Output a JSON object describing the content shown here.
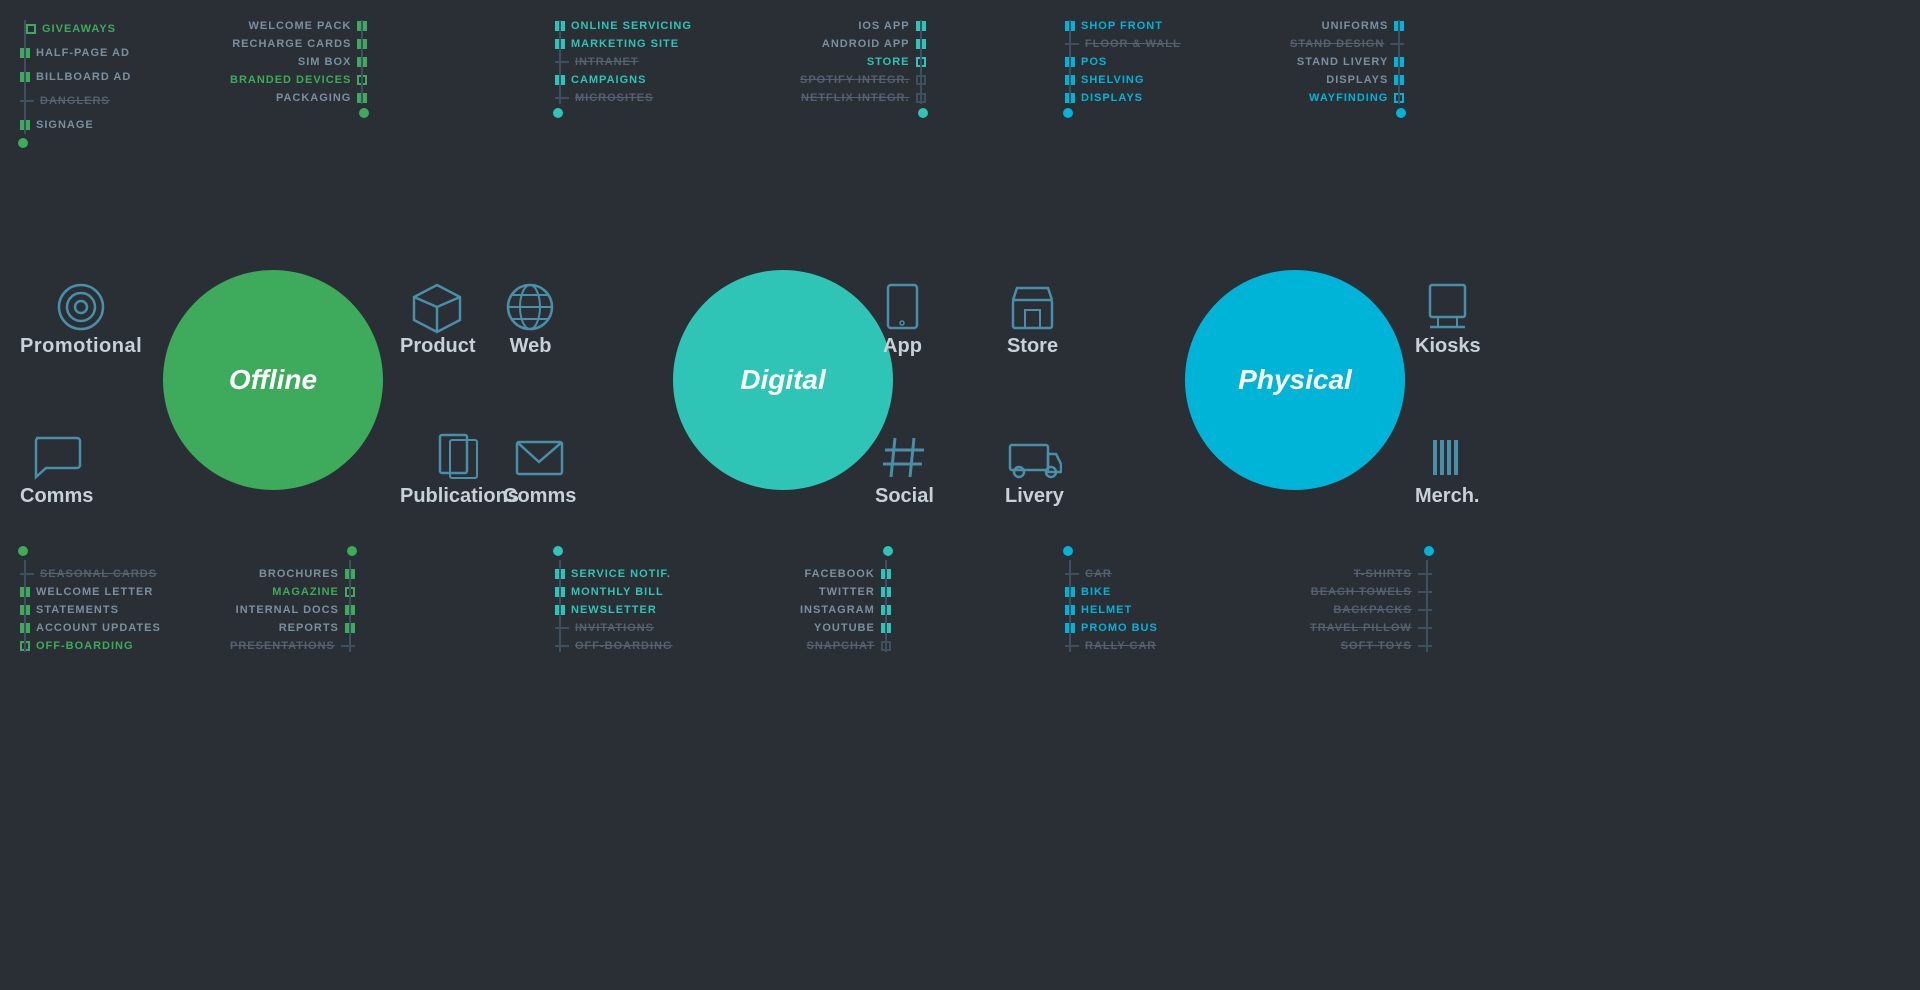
{
  "circles": [
    {
      "id": "offline",
      "label": "Offline",
      "color": "#3daa5c"
    },
    {
      "id": "digital",
      "label": "Digital",
      "color": "#2ec4b6"
    },
    {
      "id": "physical",
      "label": "Physical",
      "color": "#00b4d8"
    }
  ],
  "categories": {
    "promotional": {
      "label": "Promotional",
      "icon": "target"
    },
    "product": {
      "label": "Product",
      "icon": "box"
    },
    "web": {
      "label": "Web",
      "icon": "globe"
    },
    "app": {
      "label": "App",
      "icon": "tablet"
    },
    "store": {
      "label": "Store",
      "icon": "store"
    },
    "kiosks": {
      "label": "Kiosks",
      "icon": "kiosk"
    },
    "comms_left": {
      "label": "Comms",
      "icon": "chat"
    },
    "publications": {
      "label": "Publications",
      "icon": "tablet-alt"
    },
    "comms_right": {
      "label": "Comms",
      "icon": "mail"
    },
    "social": {
      "label": "Social",
      "icon": "hashtag"
    },
    "livery": {
      "label": "Livery",
      "icon": "truck"
    },
    "merch": {
      "label": "Merch.",
      "icon": "bars"
    }
  },
  "top_trees": {
    "promotional": {
      "left": [
        "GIVEAWAYS",
        "HALF-PAGE AD",
        "BILLBOARD AD",
        "DANGLERS",
        "SIGNAGE"
      ],
      "left_states": [
        "active",
        "green",
        "light",
        "gray",
        "light"
      ],
      "right": [
        "WELCOME PACK",
        "RECHARGE CARDS",
        "SIM BOX",
        "BRANDED DEVICES",
        "PACKAGING"
      ],
      "right_states": [
        "light",
        "light",
        "light",
        "green",
        "light"
      ]
    },
    "web_digital": {
      "left": [
        "ONLINE SERVICING",
        "MARKETING SITE",
        "INTRANET",
        "CAMPAIGNS",
        "MICROSITES"
      ],
      "left_states": [
        "cyan",
        "cyan",
        "gray",
        "cyan",
        "gray"
      ],
      "right": [
        "IOS APP",
        "ANDROID APP",
        "STORE",
        "SPOTIFY INTEGR.",
        "NETFLIX INTEGR."
      ],
      "right_states": [
        "light",
        "light",
        "cyan",
        "gray",
        "gray"
      ]
    },
    "store_physical": {
      "left": [
        "SHOP FRONT",
        "FLOOR & WALL",
        "POS",
        "SHELVING",
        "DISPLAYS"
      ],
      "left_states": [
        "blue",
        "gray",
        "blue",
        "blue",
        "blue"
      ],
      "right": [
        "UNIFORMS",
        "STAND DESIGN",
        "STAND LIVERY",
        "DISPLAYS",
        "WAYFINDING"
      ],
      "right_states": [
        "light",
        "gray",
        "light",
        "light",
        "blue"
      ]
    }
  },
  "bottom_trees": {
    "comms_left": {
      "left": [
        "SEASONAL CARDS",
        "WELCOME LETTER",
        "STATEMENTS",
        "ACCOUNT UPDATES",
        "OFF-BOARDING"
      ],
      "left_states": [
        "gray",
        "green",
        "green",
        "green",
        "green"
      ],
      "right": [
        "BROCHURES",
        "MAGAZINE",
        "INTERNAL DOCS",
        "REPORTS",
        "PRESENTATIONS"
      ],
      "right_states": [
        "green",
        "green",
        "light",
        "light",
        "gray"
      ]
    },
    "comms_right": {
      "left": [
        "SERVICE NOTIF.",
        "MONTHLY BILL",
        "NEWSLETTER",
        "INVITATIONS",
        "OFF-BOARDING"
      ],
      "left_states": [
        "cyan",
        "cyan",
        "cyan",
        "gray",
        "gray"
      ],
      "right": [
        "FACEBOOK",
        "TWITTER",
        "INSTAGRAM",
        "YOUTUBE",
        "SNAPCHAT"
      ],
      "right_states": [
        "light",
        "light",
        "light",
        "light",
        "gray"
      ]
    },
    "livery_merch": {
      "left": [
        "CAR",
        "BIKE",
        "HELMET",
        "PROMO BUS",
        "RALLY CAR"
      ],
      "left_states": [
        "gray",
        "blue",
        "blue",
        "blue",
        "gray"
      ],
      "right": [
        "T-SHIRTS",
        "BEACH TOWELS",
        "BACKPACKS",
        "TRAVEL PILLOW",
        "SOFT TOYS"
      ],
      "right_states": [
        "gray",
        "gray",
        "gray",
        "gray",
        "gray"
      ]
    }
  }
}
